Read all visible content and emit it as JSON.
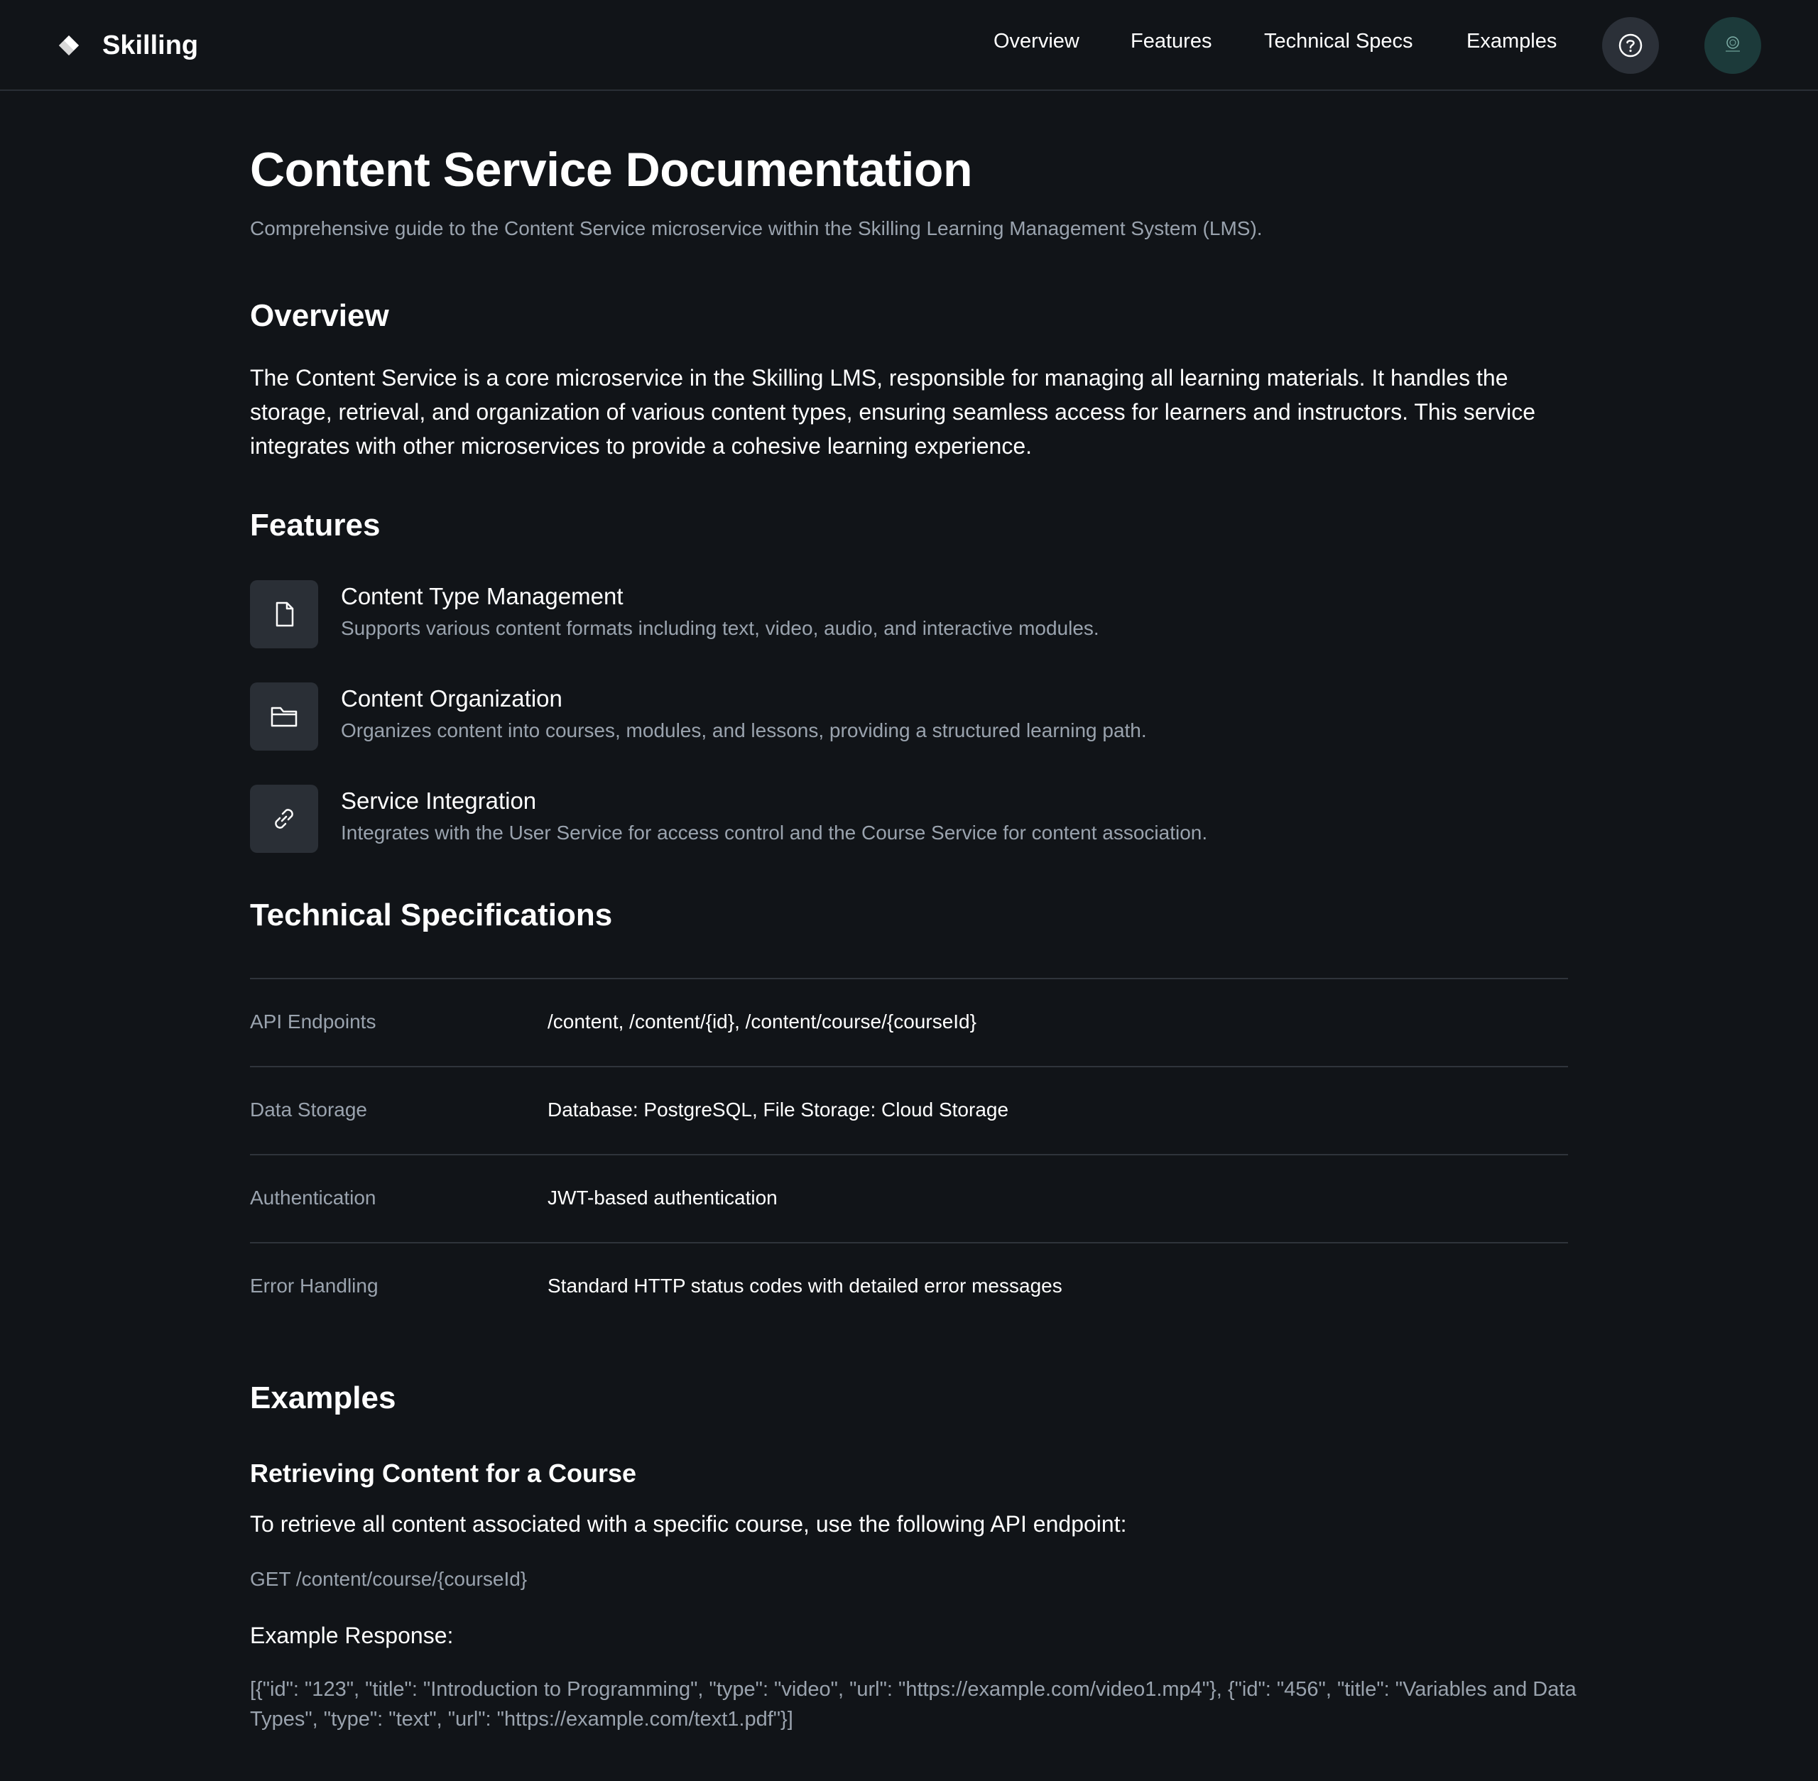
{
  "app": {
    "name": "Skilling"
  },
  "nav": {
    "items": [
      {
        "label": "Overview"
      },
      {
        "label": "Features"
      },
      {
        "label": "Technical Specs"
      },
      {
        "label": "Examples"
      }
    ],
    "help_icon": "question-circle-icon",
    "avatar_icon": "user-avatar"
  },
  "page": {
    "title": "Content Service Documentation",
    "subtitle": "Comprehensive guide to the Content Service microservice within the Skilling Learning Management System (LMS)."
  },
  "overview": {
    "heading": "Overview",
    "body": "The Content Service is a core microservice in the Skilling LMS, responsible for managing all learning materials. It handles the storage, retrieval, and organization of various content types, ensuring seamless access for learners and instructors. This service integrates with other microservices to provide a cohesive learning experience."
  },
  "features": {
    "heading": "Features",
    "items": [
      {
        "icon": "document-icon",
        "title": "Content Type Management",
        "description": "Supports various content formats including text, video, audio, and interactive modules."
      },
      {
        "icon": "folder-icon",
        "title": "Content Organization",
        "description": "Organizes content into courses, modules, and lessons, providing a structured learning path."
      },
      {
        "icon": "link-icon",
        "title": "Service Integration",
        "description": "Integrates with the User Service for access control and the Course Service for content association."
      }
    ]
  },
  "specs": {
    "heading": "Technical Specifications",
    "rows": [
      {
        "label": "API Endpoints",
        "value": "/content, /content/{id}, /content/course/{courseId}"
      },
      {
        "label": "Data Storage",
        "value": "Database: PostgreSQL, File Storage: Cloud Storage"
      },
      {
        "label": "Authentication",
        "value": "JWT-based authentication"
      },
      {
        "label": "Error Handling",
        "value": "Standard HTTP status codes with detailed error messages"
      }
    ]
  },
  "examples": {
    "heading": "Examples",
    "sub_heading": "Retrieving Content for a Course",
    "intro": "To retrieve all content associated with a specific course, use the following API endpoint:",
    "request": "GET /content/course/{courseId}",
    "response_label": "Example Response:",
    "response_body": "[{\"id\": \"123\", \"title\": \"Introduction to Programming\", \"type\": \"video\", \"url\": \"https://example.com/video1.mp4\"}, {\"id\": \"456\", \"title\": \"Variables and Data Types\", \"type\": \"text\", \"url\": \"https://example.com/text1.pdf\"}]"
  },
  "colors": {
    "background": "#111418",
    "muted_text": "#9aa3ae",
    "icon_tile": "#2a2f36",
    "avatar_bg": "#1c3a3a"
  }
}
